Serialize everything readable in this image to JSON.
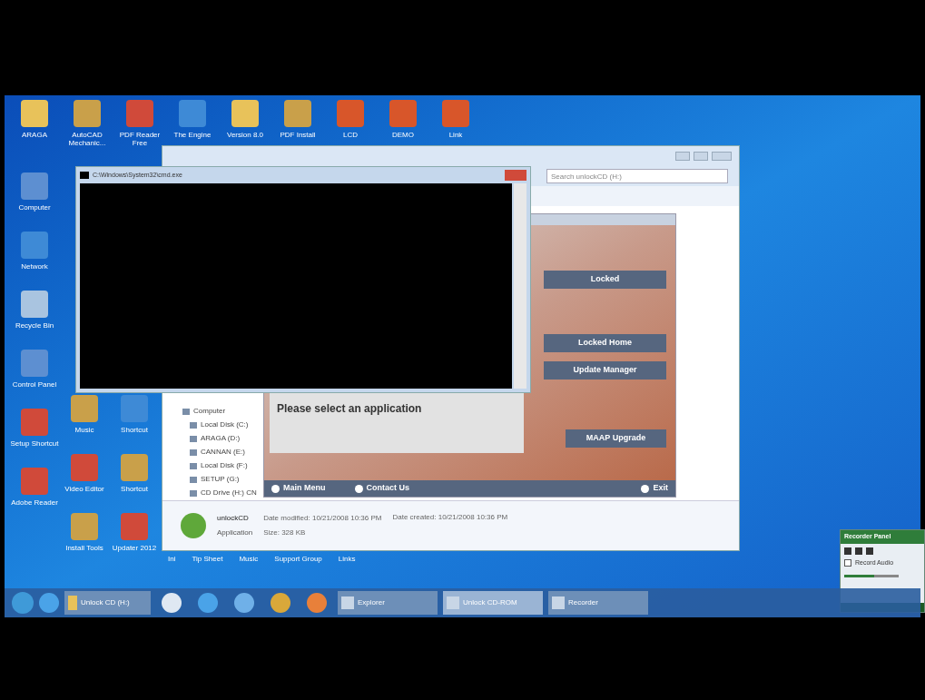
{
  "desktop": {
    "top_icons": [
      {
        "label": "ARAGA",
        "kind": "folder"
      },
      {
        "label": "AutoCAD Mechanic...",
        "kind": "app"
      },
      {
        "label": "PDF Reader Free",
        "kind": "pdf"
      },
      {
        "label": "The Engine",
        "kind": "globe"
      },
      {
        "label": "Version 8.0",
        "kind": "folder"
      },
      {
        "label": "PDF Install",
        "kind": "app"
      },
      {
        "label": "LCD",
        "kind": "r"
      },
      {
        "label": "DEMO",
        "kind": "r"
      },
      {
        "label": "Link",
        "kind": "r"
      }
    ],
    "left_icons": [
      {
        "label": "Computer",
        "kind": "computer"
      },
      {
        "label": "Network",
        "kind": "globe"
      },
      {
        "label": "Recycle Bin",
        "kind": "bin"
      },
      {
        "label": "Control Panel",
        "kind": "computer"
      },
      {
        "label": "Setup Shortcut",
        "kind": "pdf"
      },
      {
        "label": "Adobe Reader",
        "kind": "pdf"
      }
    ],
    "mid_icons": [
      {
        "label": "Music",
        "kind": "app"
      },
      {
        "label": "Video Editor",
        "kind": "pdf"
      },
      {
        "label": "Install Tools",
        "kind": "app"
      }
    ],
    "right_icons": [
      {
        "label": "Shortcut",
        "kind": "globe"
      },
      {
        "label": "Shortcut",
        "kind": "app"
      },
      {
        "label": "Updater 2012",
        "kind": "pdf"
      }
    ],
    "bottom_labels": [
      "Ini",
      "Tip Sheet",
      "Music",
      "Support Group",
      "Links"
    ]
  },
  "console": {
    "title": "C:\\Windows\\System32\\cmd.exe"
  },
  "explorer": {
    "search": {
      "placeholder": "Search unlockCD (H:)"
    },
    "tree": [
      {
        "label": "Computer",
        "children": [
          {
            "label": "Local Disk (C:)"
          },
          {
            "label": "ARAGA (D:)"
          },
          {
            "label": "CANNAN (E:)"
          },
          {
            "label": "Local Disk (F:)"
          },
          {
            "label": "SETUP (G:)"
          },
          {
            "label": "CD Drive (H:) CN"
          }
        ]
      }
    ],
    "details": {
      "name": "unlockCD",
      "type": "Application",
      "modified": "Date modified: 10/21/2008 10:36 PM",
      "created": "Date created: 10/21/2008 10:36 PM",
      "size": "Size: 328 KB"
    }
  },
  "app": {
    "buttons": [
      "Locked",
      "Locked Home",
      "Update Manager",
      "MAAP Upgrade"
    ],
    "prompt": "Please select an application",
    "footer": [
      "Main Menu",
      "Contact Us",
      "Exit"
    ]
  },
  "taskbar": {
    "pinned": [
      {
        "kind": "browser"
      },
      {
        "kind": "settings"
      },
      {
        "kind": "browser"
      },
      {
        "kind": "cloud"
      },
      {
        "kind": "chrome"
      },
      {
        "kind": "media"
      }
    ],
    "folder_label": "Unlock CD (H:)",
    "windows": [
      {
        "label": "Explorer",
        "selected": false
      },
      {
        "label": "Unlock CD-ROM",
        "selected": true
      },
      {
        "label": "Recorder",
        "selected": false
      }
    ]
  },
  "recorder": {
    "title": "Recorder Panel",
    "record_audio": {
      "label": "Record Audio",
      "checked": false
    },
    "volume": {
      "level": 0.55
    }
  }
}
